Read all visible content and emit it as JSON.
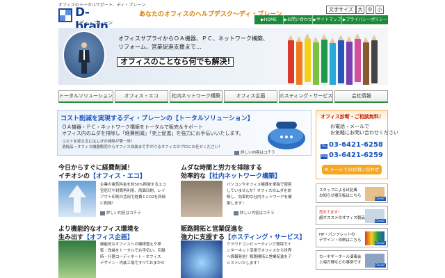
{
  "header": {
    "tagline": "オフィスのトータルサポート、ディ・ブレーン",
    "logo_name": "D-brain",
    "logo_sub": "ディ・ブレーン",
    "catchphrase": "あなたのオフィスのヘルプデスク〜ディ・ブレーン",
    "font_size_label": "文字サイズ",
    "font_sizes": [
      "大",
      "中",
      "小"
    ]
  },
  "top_nav": [
    "▶HOME",
    "▶お問い合わせ",
    "▶サイトマップ",
    "▶プライバシーポリシー"
  ],
  "hero": {
    "lines": [
      "オフィスサプライからＯＡ機器、ＰＣ、ネットワーク構築、",
      "リフォーム、営業促進支援まで…"
    ],
    "banner": "オフィスのことなら何でも解決!"
  },
  "main_nav": [
    "トータルソリューション",
    "オフィス・エコ",
    "社内ネットワーク構築",
    "オフィス企画",
    "ホスティング・サービス",
    "会社情報"
  ],
  "feature": {
    "title": "コスト削減を実現するディ・ブレーンの【トータルソリューション】",
    "line1": "ＯＡ機器・ＰＣ・ネットワーク構築をトータルで販売＆サポート",
    "line2": "オフィス内のムダを排除し「経費削減」「売上促進」を強力にお手伝いいたします。",
    "small1": "コストを抑えるにはムダの排除が第一歩！",
    "small2": "消耗品・オフィス機器販売からオフィス改装まで手がけるオフィスのプロにお任せください！",
    "detail": "詳しい内容はコチラ"
  },
  "side_contact": {
    "title": "オフィス診断・ご相談無料！",
    "line1": "お電話・メールで",
    "line2": "お気軽にお問い合わせください",
    "tel_label": "TEL",
    "tel": "03-6421-6258",
    "fax_label": "FAX",
    "fax": "03-6421-6259",
    "mail_button": "メールでのお問い合わせ"
  },
  "sections": [
    {
      "title1": "今日からすぐに経費削減！",
      "title2a": "イチオシの",
      "title2b": "【オフィス・エコ】",
      "lines": [
        "企業の電気料金を約50%削減するエコ",
        "宝尼灯や封筒再利用、両面印刷、レイ",
        "アウト印刷の活用で経費とCO2を同時",
        "に削減！"
      ],
      "detail": "詳しい内容はコチラ"
    },
    {
      "title1": "ムダな時間と労力を排除する",
      "title2a": "効率的な",
      "title2b": "【社内ネットワーク構築】",
      "lines": [
        "パソコンやオフィス機器を単独で使用",
        "していませんか？オフィスのムダを診",
        "断し、効率的な社内ネットワークを構",
        "築します！"
      ],
      "detail": "詳しい内容はコチラ"
    },
    {
      "title1": "より機能的なオフィス環境を",
      "title2a": "生み出す",
      "title2b": "【オフィス企画】",
      "lines": [
        "機能的なオフィスへの模様替えや移",
        "転・改装をトータルでお手伝い。引越",
        "時・什器コーディネート・オフィス",
        "デザイン・内装工場ですべておまかせ"
      ],
      "detail": ""
    },
    {
      "title1": "販路開拓と営業促進を",
      "title2a": "強力に支援する",
      "title2b": "【ホスティング・サービス】",
      "lines": [
        "クラウドコンピューティング環境でイ",
        "ンターネット活用でオフィスから世界",
        "へ情報発信！販路開拓と営業促進をア",
        "シストいたします！"
      ],
      "detail": ""
    }
  ],
  "ads": [
    {
      "l1": "スタッフによる日記風",
      "l2": "お知らせ掲示板はこちら",
      "cta": "Check!"
    },
    {
      "l1": "売れてます！",
      "l2": "超オススメのオフィス製品",
      "cta": "Check!"
    },
    {
      "l1": "HP・パンフレットの",
      "l2": "デザイン・印刷はこちら",
      "cta": "Check!"
    },
    {
      "l1": "カーネギーホール演奏会",
      "l2": "上海万博などの事例です",
      "cta": "Check!"
    }
  ]
}
